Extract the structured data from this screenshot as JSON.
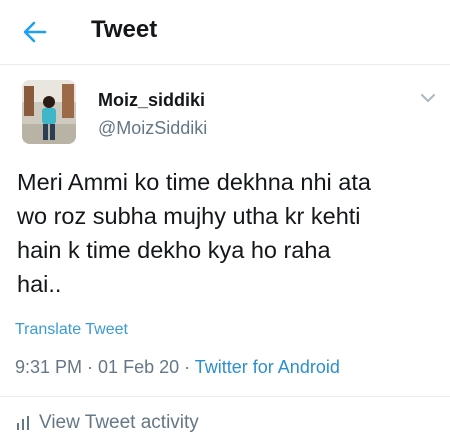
{
  "header": {
    "back_icon": "arrow-left-icon",
    "title": "Tweet",
    "accent_color": "#1da1f2"
  },
  "tweet": {
    "author_name": "Moiz_siddiki",
    "author_handle": "@MoizSiddiki",
    "menu_icon": "chevron-down-icon",
    "text": "Meri Ammi ko time dekhna nhi ata\nwo roz subha mujhy utha kr kehti\nhain k time dekho kya ho raha\nhai..",
    "translate_label": "Translate Tweet",
    "time": "9:31 PM",
    "separator": " · ",
    "date": "01 Feb 20",
    "source": "Twitter for Android"
  },
  "activity": {
    "icon": "bar-chart-icon",
    "label": "View Tweet activity"
  }
}
